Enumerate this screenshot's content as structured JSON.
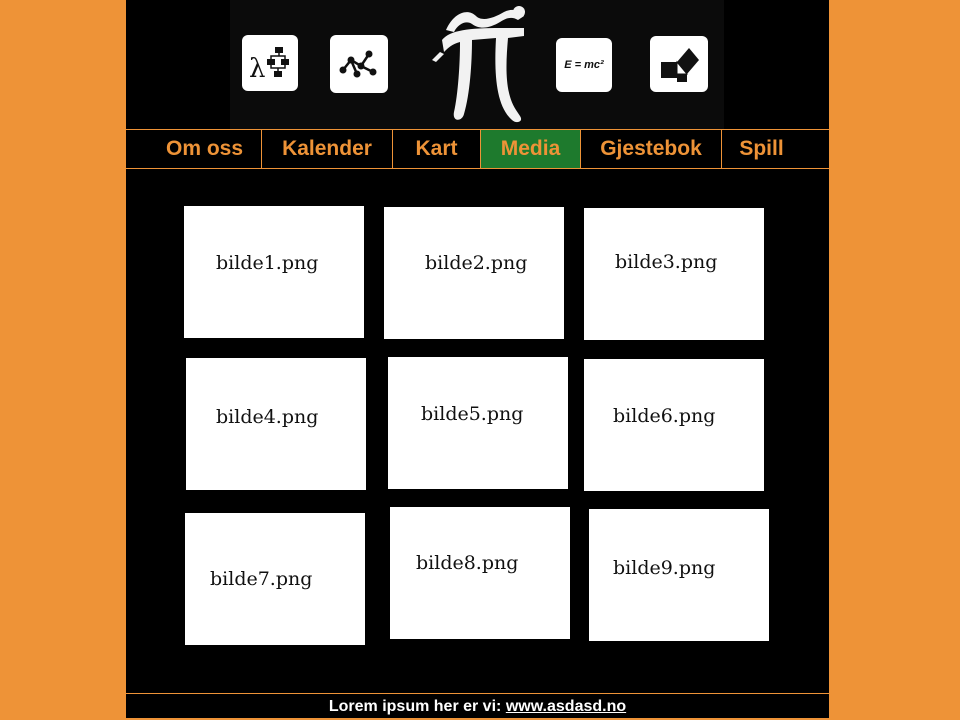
{
  "banner": {
    "icons": [
      "lambda-flowchart-icon",
      "graph-nodes-icon",
      "pi-figure-logo",
      "emc2-icon",
      "pythagoras-icon"
    ],
    "emc2_text": "E = mc²"
  },
  "nav": {
    "items": [
      {
        "label": "Om oss"
      },
      {
        "label": "Kalender"
      },
      {
        "label": "Kart"
      },
      {
        "label": "Media",
        "active": true
      },
      {
        "label": "Gjestebok"
      },
      {
        "label": "Spill"
      }
    ]
  },
  "gallery": {
    "images": [
      {
        "filename": "bilde1.png"
      },
      {
        "filename": "bilde2.png"
      },
      {
        "filename": "bilde3.png"
      },
      {
        "filename": "bilde4.png"
      },
      {
        "filename": "bilde5.png"
      },
      {
        "filename": "bilde6.png"
      },
      {
        "filename": "bilde7.png"
      },
      {
        "filename": "bilde8.png"
      },
      {
        "filename": "bilde9.png"
      }
    ]
  },
  "footer": {
    "text": "Lorem ipsum her er vi:",
    "link": "www.asdasd.no"
  },
  "colors": {
    "background": "#ee9337",
    "page": "#000000",
    "accent": "#ee9337",
    "active_tab": "#1e7a2d"
  }
}
